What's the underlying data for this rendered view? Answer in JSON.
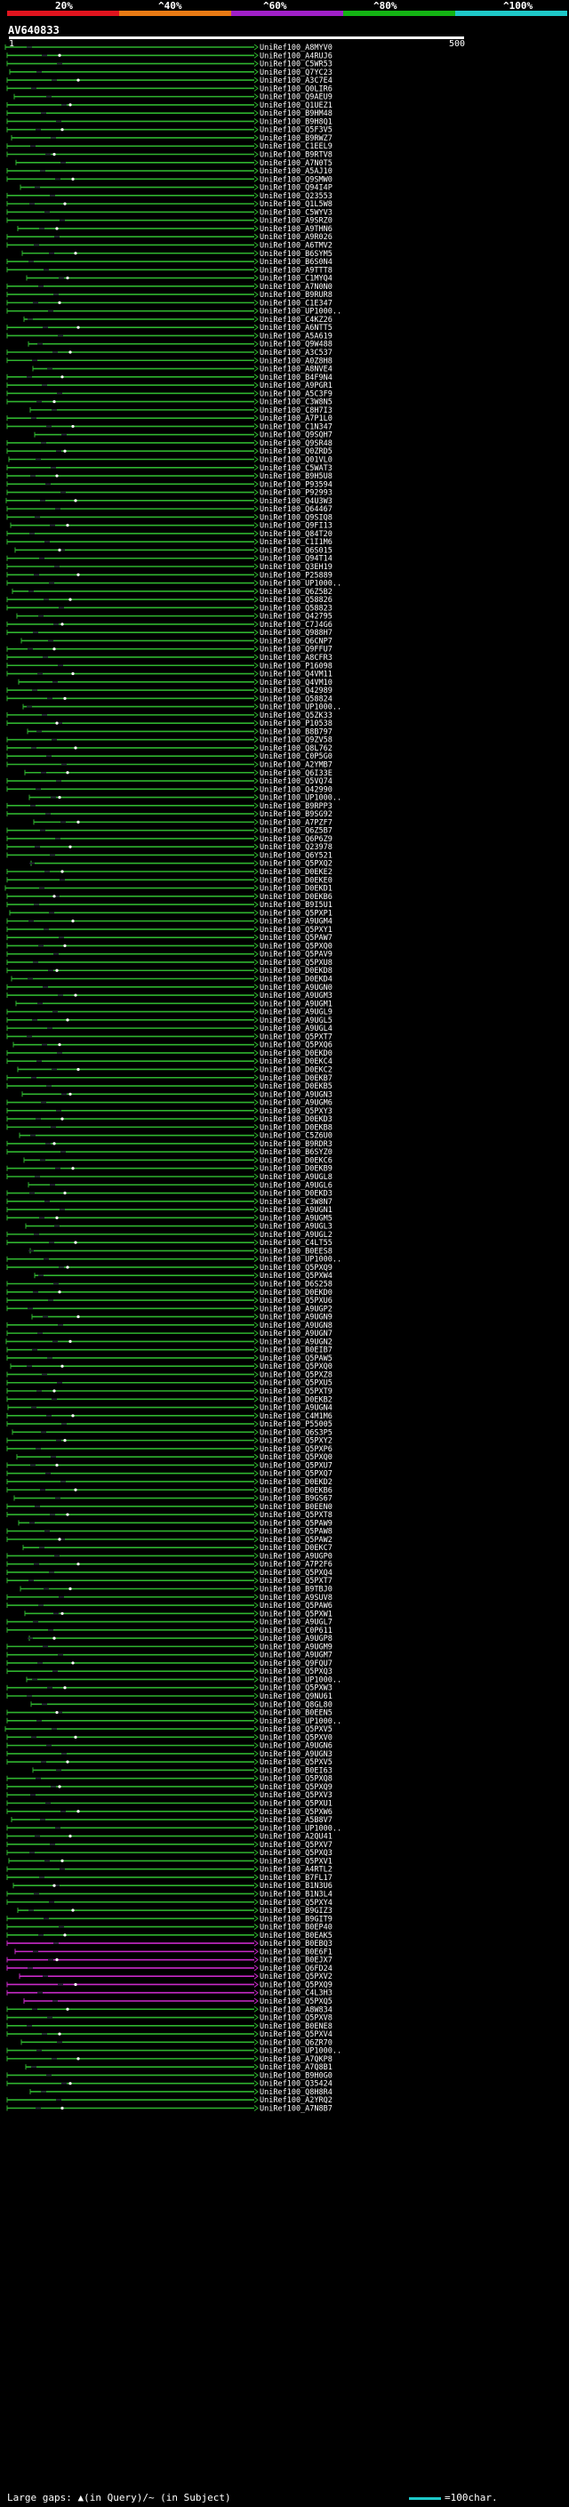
{
  "query": "AV640833",
  "legend": {
    "labels": [
      "20%",
      "^40%",
      "^60%",
      "^80%",
      "^100%"
    ],
    "colors": [
      "#e0141e",
      "#e87a14",
      "#a020c8",
      "#14b414",
      "#1ec8c8"
    ]
  },
  "ruler": {
    "start": "1",
    "end": "500"
  },
  "footer": {
    "left": "Large gaps: ▲(in Query)/~ (in Subject)",
    "right": "=100char."
  },
  "chart_data": {
    "type": "alignment-overview",
    "query_length": 500,
    "hits": [
      "UniRef100_A8MYV0",
      "UniRef100_A4RUJ6",
      "UniRef100_C5WR53",
      "UniRef100_Q7YC23",
      "UniRef100_A3C7E4",
      "UniRef100_Q0LIR6",
      "UniRef100_Q9AEU9",
      "UniRef100_Q1UEZ1",
      "UniRef100_B9HM48",
      "UniRef100_B9H8Q1",
      "UniRef100_Q5F3V5",
      "UniRef100_B9RWZ7",
      "UniRef100_C1EEL9",
      "UniRef100_B9RTV8",
      "UniRef100_A7N0T5",
      "UniRef100_A5AJ10",
      "UniRef100_Q9SMW0",
      "UniRef100_Q94I4P",
      "UniRef100_Q23553",
      "UniRef100_Q1L5W8",
      "UniRef100_C5WYV3",
      "UniRef100_A9SRZ0",
      "UniRef100_A9THN6",
      "UniRef100_A9R026",
      "UniRef100_A6TMV2",
      "UniRef100_B6SYM5",
      "UniRef100_B6S0N4",
      "UniRef100_A9TTT8",
      "UniRef100_C1MYQ4",
      "UniRef100_A7N0N0",
      "UniRef100_B9RUR8",
      "UniRef100_C1E347",
      "UniRef100_UP1000..",
      "UniRef100_C4KZ26",
      "UniRef100_A6NTT5",
      "UniRef100_A5A619",
      "UniRef100_Q9W488",
      "UniRef100_A3C537",
      "UniRef100_A0Z8H8",
      "UniRef100_A8NVE4",
      "UniRef100_B4F9N4",
      "UniRef100_A9PGR1",
      "UniRef100_A5C3F9",
      "UniRef100_C3W8N5",
      "UniRef100_C8H7I3",
      "UniRef100_A7P1L0",
      "UniRef100_C1N347",
      "UniRef100_Q9SQH7",
      "UniRef100_Q9SR48",
      "UniRef100_Q0ZRD5",
      "UniRef100_Q01VL0",
      "UniRef100_C5WAT3",
      "UniRef100_B9H5U8",
      "UniRef100_P93594",
      "UniRef100_P92993",
      "UniRef100_Q4U3W3",
      "UniRef100_Q64467",
      "UniRef100_Q9SIQ8",
      "UniRef100_Q9FI13",
      "UniRef100_Q84T20",
      "UniRef100_C1I1M6",
      "UniRef100_Q6S015",
      "UniRef100_Q94T14",
      "UniRef100_Q3EH19",
      "UniRef100_P25889",
      "UniRef100_UP1000..",
      "UniRef100_Q6Z5B2",
      "UniRef100_Q58826",
      "UniRef100_Q58823",
      "UniRef100_Q42795",
      "UniRef100_C7J4G6",
      "UniRef100_Q988H7",
      "UniRef100_Q6CNP7",
      "UniRef100_Q9FFU7",
      "UniRef100_A8CFR3",
      "UniRef100_P16098",
      "UniRef100_Q4VM11",
      "UniRef100_Q4VM10",
      "UniRef100_Q42989",
      "UniRef100_Q58824",
      "UniRef100_UP1000..",
      "UniRef100_Q5ZK33",
      "UniRef100_P10538",
      "UniRef100_B8B797",
      "UniRef100_Q9ZV58",
      "UniRef100_Q8L762",
      "UniRef100_C0P5G0",
      "UniRef100_A2YMB7",
      "UniRef100_Q6I33E",
      "UniRef100_Q5VQ74",
      "UniRef100_Q42990",
      "UniRef100_UP1000..",
      "UniRef100_B9RPP3",
      "UniRef100_B9SG92",
      "UniRef100_A7PZF7",
      "UniRef100_Q6Z5B7",
      "UniRef100_Q6P6Z9",
      "UniRef100_Q23978",
      "UniRef100_Q6Y521",
      "UniRef100_Q5PXQ2",
      "UniRef100_D0EKE2",
      "UniRef100_D0EKE0",
      "UniRef100_D0EKD1",
      "UniRef100_D0EKB6",
      "UniRef100_B9I5U1",
      "UniRef100_Q5PXP1",
      "UniRef100_A9UGM4",
      "UniRef100_Q5PXY1",
      "UniRef100_Q5PAW7",
      "UniRef100_Q5PXQ0",
      "UniRef100_Q5PAV9",
      "UniRef100_Q5PXU8",
      "UniRef100_D0EKD8",
      "UniRef100_D0EKD4",
      "UniRef100_A9UGN0",
      "UniRef100_A9UGM3",
      "UniRef100_A9UGM1",
      "UniRef100_A9UGL9",
      "UniRef100_A9UGL5",
      "UniRef100_A9UGL4",
      "UniRef100_Q5PXT7",
      "UniRef100_Q5PXQ6",
      "UniRef100_D0EKD0",
      "UniRef100_D0EKC4",
      "UniRef100_D0EKC2",
      "UniRef100_D0EKB7",
      "UniRef100_D0EKB5",
      "UniRef100_A9UGN3",
      "UniRef100_A9UGM6",
      "UniRef100_Q5PXY3",
      "UniRef100_D0EKD3",
      "UniRef100_D0EKB8",
      "UniRef100_C5Z6U0",
      "UniRef100_B9RDR3",
      "UniRef100_B6SYZ0",
      "UniRef100_D0EKC6",
      "UniRef100_D0EKB9",
      "UniRef100_A9UGL8",
      "UniRef100_A9UGL6",
      "UniRef100_D0EKD3",
      "UniRef100_C3W8N7",
      "UniRef100_A9UGN1",
      "UniRef100_A9UGM5",
      "UniRef100_A9UGL3",
      "UniRef100_A9UGL2",
      "UniRef100_C4LT55",
      "UniRef100_B0EES8",
      "UniRef100_UP1000..",
      "UniRef100_Q5PXQ9",
      "UniRef100_Q5PXW4",
      "UniRef100_D6S258",
      "UniRef100_D0EKD0",
      "UniRef100_Q5PXU6",
      "UniRef100_A9UGP2",
      "UniRef100_A9UGN9",
      "UniRef100_A9UGN8",
      "UniRef100_A9UGN7",
      "UniRef100_A9UGN2",
      "UniRef100_B0EIB7",
      "UniRef100_Q5PAW5",
      "UniRef100_Q5PXQ0",
      "UniRef100_Q5PXZ8",
      "UniRef100_Q5PXU5",
      "UniRef100_Q5PXT9",
      "UniRef100_D0EKB2",
      "UniRef100_A9UGN4",
      "UniRef100_C4M1M6",
      "UniRef100_P55005",
      "UniRef100_Q6S3P5",
      "UniRef100_Q5PXY2",
      "UniRef100_Q5PXP6",
      "UniRef100_Q5PXQ0",
      "UniRef100_Q5PXU7",
      "UniRef100_Q5PXQ7",
      "UniRef100_D0EKD2",
      "UniRef100_D0EKB6",
      "UniRef100_B9GS67",
      "UniRef100_B0EEN0",
      "UniRef100_Q5PXT8",
      "UniRef100_Q5PAW9",
      "UniRef100_Q5PAW8",
      "UniRef100_Q5PAW2",
      "UniRef100_D0EKC7",
      "UniRef100_A9UGP0",
      "UniRef100_A7P2F6",
      "UniRef100_Q5PXQ4",
      "UniRef100_Q5PXT7",
      "UniRef100_B9TBJ0",
      "UniRef100_A9SUV8",
      "UniRef100_Q5PAW6",
      "UniRef100_Q5PXW1",
      "UniRef100_A9UGL7",
      "UniRef100_C0P611",
      "UniRef100_A9UGP8",
      "UniRef100_A9UGM9",
      "UniRef100_A9UGM7",
      "UniRef100_Q9FQU7",
      "UniRef100_Q5PXQ3",
      "UniRef100_UP1000..",
      "UniRef100_Q5PXW3",
      "UniRef100_Q9NU61",
      "UniRef100_Q8GL80",
      "UniRef100_B0EEN5",
      "UniRef100_UP1000..",
      "UniRef100_Q5PXV5",
      "UniRef100_Q5PXV0",
      "UniRef100_A9UGN6",
      "UniRef100_A9UGN3",
      "UniRef100_Q5PXV5",
      "UniRef100_B0EI63",
      "UniRef100_Q5PXQ8",
      "UniRef100_Q5PXQ9",
      "UniRef100_Q5PXV3",
      "UniRef100_Q5PXU1",
      "UniRef100_Q5PXW6",
      "UniRef100_A5B8V7",
      "UniRef100_UP1000..",
      "UniRef100_A2QU41",
      "UniRef100_Q5PXV7",
      "UniRef100_Q5PXQ3",
      "UniRef100_Q5PXV1",
      "UniRef100_A4RTL2",
      "UniRef100_B7FL17",
      "UniRef100_B1N3U6",
      "UniRef100_B1N3L4",
      "UniRef100_Q5PXY4",
      "UniRef100_B9GIZ3",
      "UniRef100_B9GIT9",
      "UniRef100_B0EP40",
      "UniRef100_B0EAK5",
      "UniRef100_B0EBQ3",
      "UniRef100_B0E6F1",
      "UniRef100_B0EJX7",
      "UniRef100_Q6FD24",
      "UniRef100_Q5PXV2",
      "UniRef100_Q5PXQ9",
      "UniRef100_C4L3H3",
      "UniRef100_Q5PXQ5",
      "UniRef100_A8W834",
      "UniRef100_Q5PXV8",
      "UniRef100_B0ENE8",
      "UniRef100_Q5PXV4",
      "UniRef100_Q6ZR70",
      "UniRef100_UP1000..",
      "UniRef100_A7QKP8",
      "UniRef100_A7Q8B1",
      "UniRef100_B9H0G0",
      "UniRef100_Q35424",
      "UniRef100_Q8H8R4",
      "UniRef100_A2YRQ2",
      "UniRef100_A7N8B7"
    ],
    "pink_hit_indices": [
      230,
      231,
      232,
      233,
      234,
      235,
      236,
      237,
      262,
      263,
      264,
      265,
      266,
      267,
      268,
      269,
      270,
      271,
      272,
      273,
      274,
      275,
      276,
      277,
      278,
      279,
      280,
      281,
      282,
      283,
      284,
      285,
      286,
      287,
      288,
      290,
      291,
      292,
      293,
      294,
      295
    ]
  }
}
